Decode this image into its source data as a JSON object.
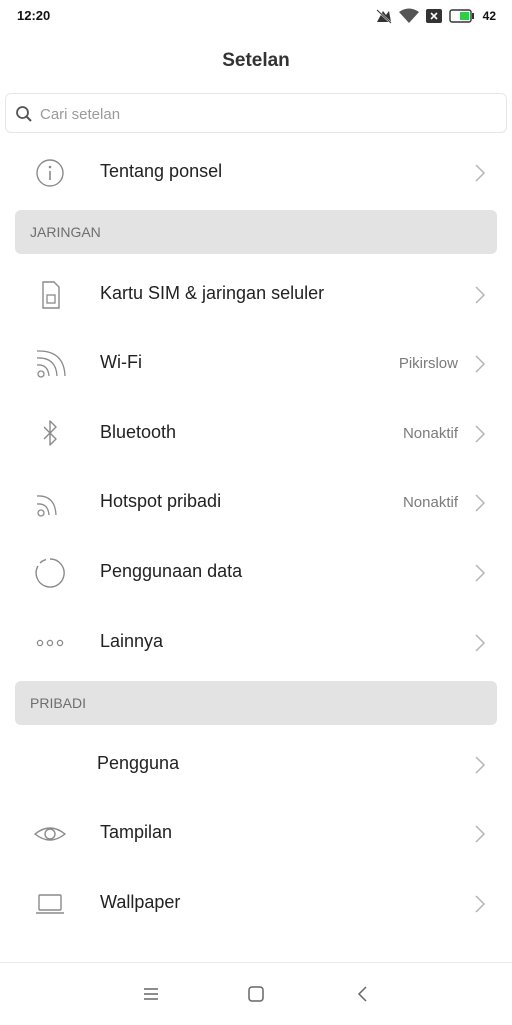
{
  "status_bar": {
    "time": "12:20",
    "battery_level": "42"
  },
  "header": {
    "title": "Setelan"
  },
  "search": {
    "placeholder": "Cari setelan"
  },
  "items": {
    "about": {
      "label": "Tentang ponsel",
      "icon": "info-icon"
    },
    "sim": {
      "label": "Kartu SIM & jaringan seluler",
      "icon": "sim-card-icon"
    },
    "wifi": {
      "label": "Wi-Fi",
      "value": "Pikirslow",
      "icon": "wifi-icon"
    },
    "bluetooth": {
      "label": "Bluetooth",
      "value": "Nonaktif",
      "icon": "bluetooth-icon"
    },
    "hotspot": {
      "label": "Hotspot pribadi",
      "value": "Nonaktif",
      "icon": "hotspot-icon"
    },
    "data_usage": {
      "label": "Penggunaan data",
      "icon": "data-usage-icon"
    },
    "more": {
      "label": "Lainnya",
      "icon": "more-dots-icon"
    },
    "users": {
      "label": "Pengguna"
    },
    "display": {
      "label": "Tampilan",
      "icon": "eye-icon"
    },
    "wallpaper": {
      "label": "Wallpaper",
      "icon": "laptop-icon"
    }
  },
  "sections": {
    "network": "JARINGAN",
    "personal": "PRIBADI"
  },
  "colors": {
    "section_bg": "#e3e3e3",
    "icon_gray": "#8a8a8a",
    "chevron": "#b5b5b5"
  }
}
